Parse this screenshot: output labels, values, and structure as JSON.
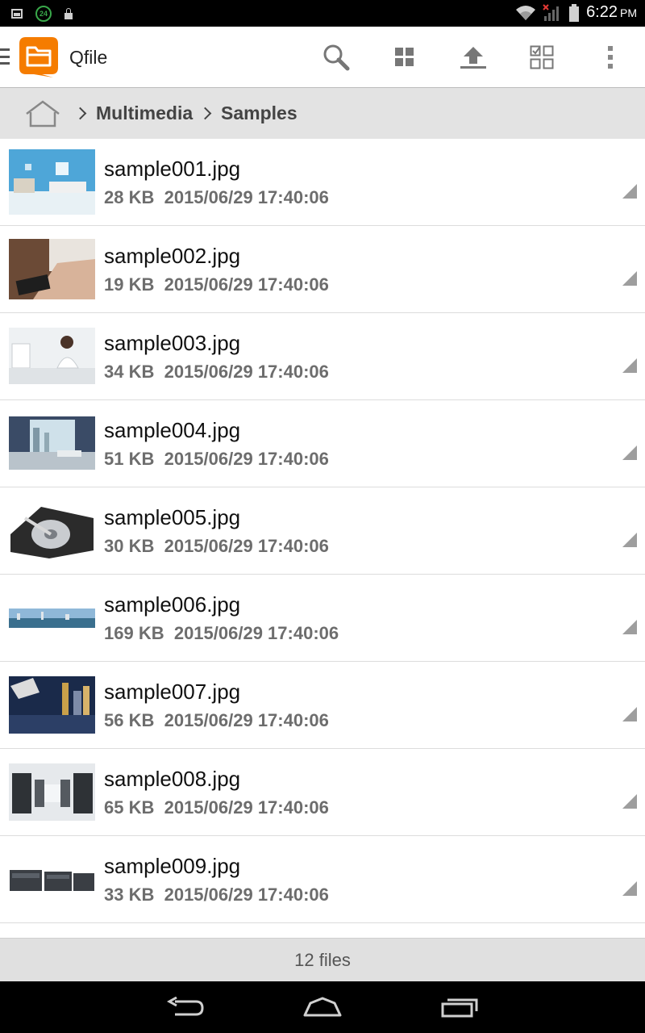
{
  "status_bar": {
    "time": "6:22",
    "ampm": "PM",
    "notification_badge": "24"
  },
  "app_bar": {
    "title": "Qfile",
    "brand_color": "#f57c00"
  },
  "breadcrumb": {
    "items": [
      "Multimedia",
      "Samples"
    ]
  },
  "files": [
    {
      "name": "sample001.jpg",
      "size": "28 KB",
      "date": "2015/06/29 17:40:06"
    },
    {
      "name": "sample002.jpg",
      "size": "19 KB",
      "date": "2015/06/29 17:40:06"
    },
    {
      "name": "sample003.jpg",
      "size": "34 KB",
      "date": "2015/06/29 17:40:06"
    },
    {
      "name": "sample004.jpg",
      "size": "51 KB",
      "date": "2015/06/29 17:40:06"
    },
    {
      "name": "sample005.jpg",
      "size": "30 KB",
      "date": "2015/06/29 17:40:06"
    },
    {
      "name": "sample006.jpg",
      "size": "169 KB",
      "date": "2015/06/29 17:40:06"
    },
    {
      "name": "sample007.jpg",
      "size": "56 KB",
      "date": "2015/06/29 17:40:06"
    },
    {
      "name": "sample008.jpg",
      "size": "65 KB",
      "date": "2015/06/29 17:40:06"
    },
    {
      "name": "sample009.jpg",
      "size": "33 KB",
      "date": "2015/06/29 17:40:06"
    }
  ],
  "footer": {
    "count": "12 files"
  }
}
